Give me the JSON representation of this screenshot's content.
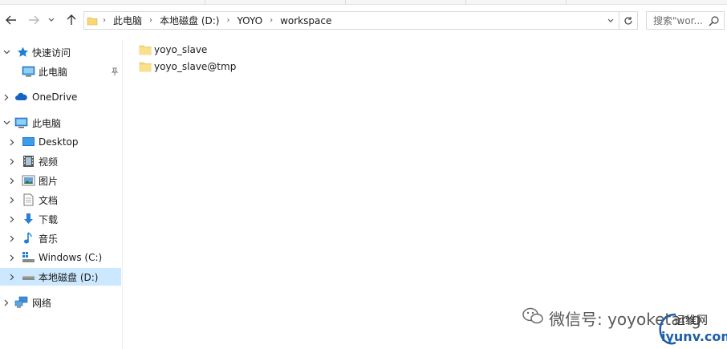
{
  "address_bar": {
    "crumbs": [
      "此电脑",
      "本地磁盘 (D:)",
      "YOYO",
      "workspace"
    ]
  },
  "search": {
    "placeholder": "搜索\"wor..."
  },
  "nav_pane": {
    "items": [
      {
        "label": "快速访问",
        "icon": "star-icon"
      },
      {
        "label": "此电脑",
        "icon": "computer-icon",
        "pinned": true
      },
      {
        "label": "OneDrive",
        "icon": "cloud-icon"
      },
      {
        "label": "此电脑",
        "icon": "computer-icon"
      },
      {
        "label": "Desktop",
        "icon": "desktop-icon"
      },
      {
        "label": "视频",
        "icon": "video-icon"
      },
      {
        "label": "图片",
        "icon": "picture-icon"
      },
      {
        "label": "文档",
        "icon": "document-icon"
      },
      {
        "label": "下载",
        "icon": "download-icon"
      },
      {
        "label": "音乐",
        "icon": "music-icon"
      },
      {
        "label": "Windows (C:)",
        "icon": "drive-c-icon"
      },
      {
        "label": "本地磁盘 (D:)",
        "icon": "drive-icon",
        "selected": true
      },
      {
        "label": "网络",
        "icon": "network-icon"
      }
    ]
  },
  "files": [
    {
      "name": "yoyo_slave",
      "icon": "folder-icon"
    },
    {
      "name": "yoyo_slave@tmp",
      "icon": "folder-icon"
    }
  ],
  "watermark": {
    "text": "微信号: yoyoketang",
    "logo_top": "运维网",
    "logo_bottom": "iyunv.com"
  },
  "colors": {
    "selection": "#cce8ff",
    "folder": "#f8d775",
    "accent_blue": "#1e7fd6"
  }
}
